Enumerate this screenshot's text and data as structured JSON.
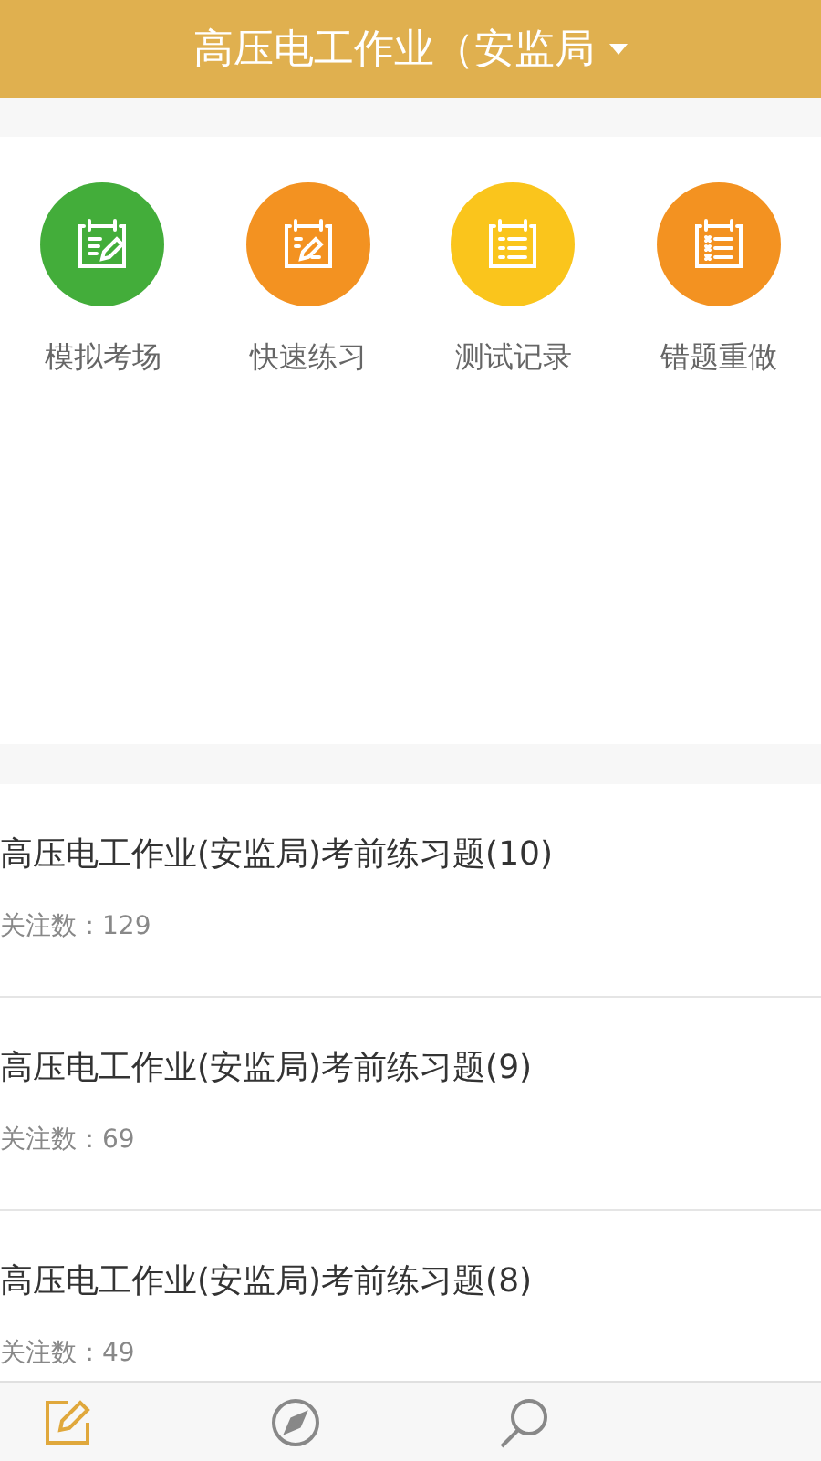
{
  "header": {
    "title": "高压电工作业（安监局"
  },
  "shortcuts": [
    {
      "label": "模拟考场",
      "color": "#43ad3a",
      "kind": "pen-list"
    },
    {
      "label": "快速练习",
      "color": "#f39221",
      "kind": "pen"
    },
    {
      "label": "测试记录",
      "color": "#fac51c",
      "kind": "list"
    },
    {
      "label": "错题重做",
      "color": "#f39221",
      "kind": "cross-list"
    }
  ],
  "papers": [
    {
      "title": "高压电工作业(安监局)考前练习题(10)",
      "followers": "关注数：129"
    },
    {
      "title": "高压电工作业(安监局)考前练习题(9)",
      "followers": "关注数：69"
    },
    {
      "title": "高压电工作业(安监局)考前练习题(8)",
      "followers": "关注数：49"
    }
  ],
  "nav": [
    {
      "kind": "edit",
      "selected": true
    },
    {
      "kind": "compass",
      "selected": false
    },
    {
      "kind": "search",
      "selected": false
    }
  ]
}
